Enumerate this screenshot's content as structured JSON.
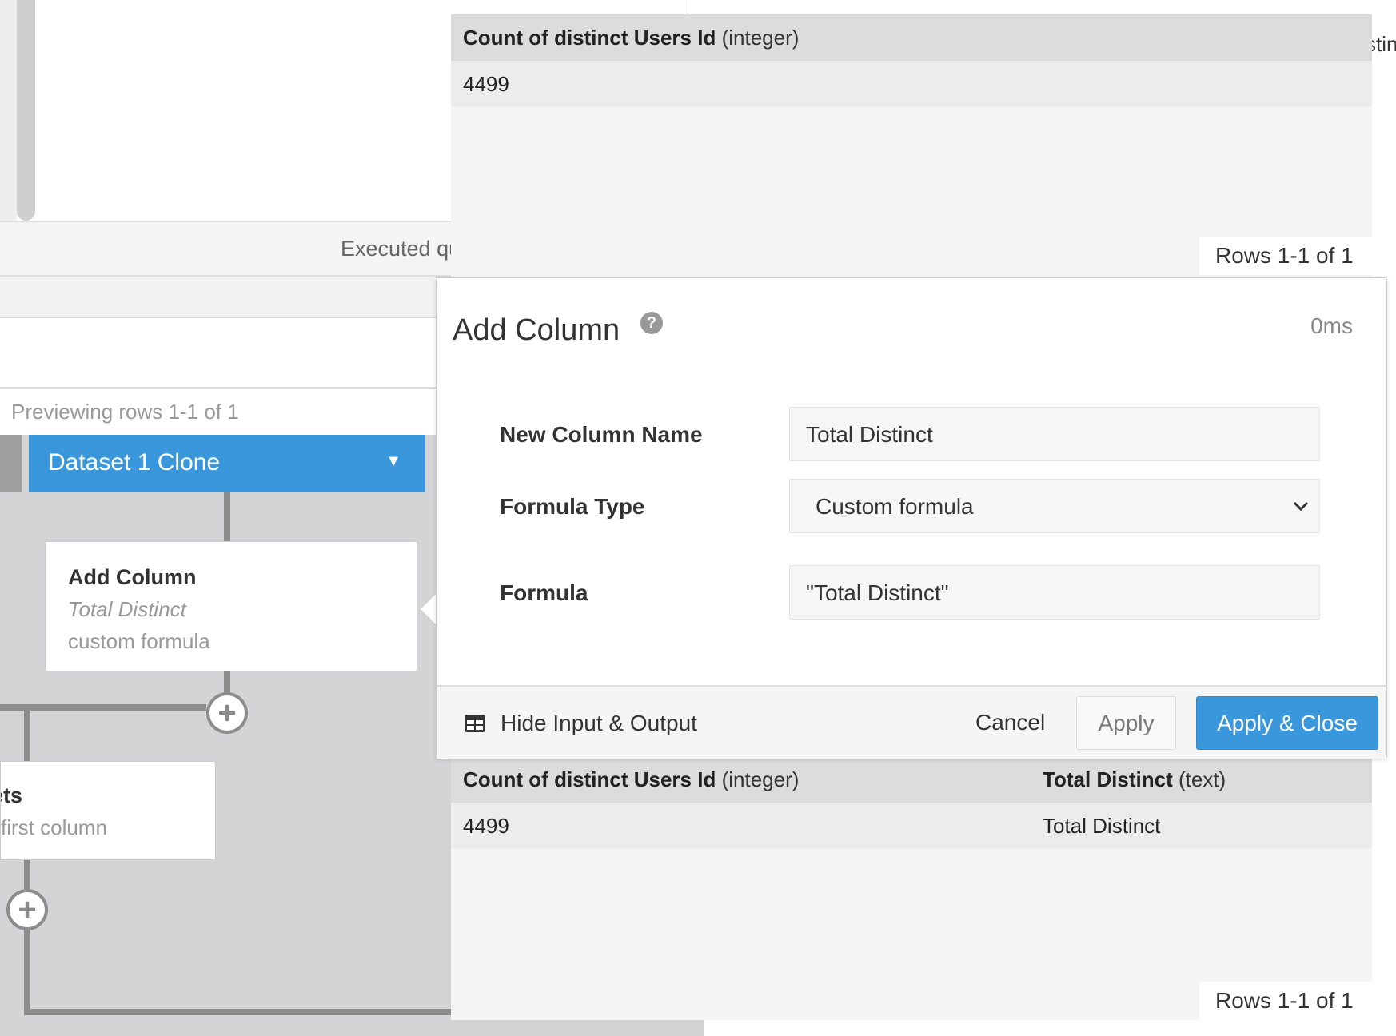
{
  "background": {
    "status_text": "Executed qu",
    "preview_text": "Previewing rows 1-1 of 1"
  },
  "workflow": {
    "dataset_label": "Dataset 1 Clone",
    "dataset_caret": "▼",
    "steps": [
      {
        "title": "Add Column",
        "subtitle": "Total Distinct",
        "detail": "custom formula"
      },
      {
        "title": "ets",
        "detail": "first column"
      }
    ],
    "add_step_symbol": "+"
  },
  "top_result": {
    "columns": [
      {
        "name": "Count of distinct Users Id",
        "type": "(integer)"
      }
    ],
    "rows": [
      [
        "4499"
      ]
    ],
    "rows_info": "Rows 1-1 of 1",
    "edge_header_fragment": "stin"
  },
  "popup": {
    "title": "Add Column",
    "help_symbol": "?",
    "timer": "0ms",
    "fields": {
      "new_column_name": {
        "label": "New Column Name",
        "value": "Total Distinct"
      },
      "formula_type": {
        "label": "Formula Type",
        "selected": "Custom formula"
      },
      "formula": {
        "label": "Formula",
        "value": "\"Total Distinct\""
      }
    },
    "footer": {
      "hide_label": "Hide Input & Output",
      "cancel_label": "Cancel",
      "apply_label": "Apply",
      "apply_close_label": "Apply & Close"
    }
  },
  "bottom_result": {
    "columns": [
      {
        "name": "Count of distinct Users Id",
        "type": "(integer)"
      },
      {
        "name": "Total Distinct",
        "type": "(text)"
      }
    ],
    "rows": [
      [
        "4499",
        "Total Distinct"
      ]
    ],
    "rows_info": "Rows 1-1 of 1"
  },
  "colors": {
    "accent": "#3b97dc",
    "canvas": "#d4d4d6",
    "table_header": "#dcdcdc",
    "table_row": "#ececec"
  },
  "icons": {
    "help": "question-circle-icon",
    "select": "chevron-down-icon",
    "hide": "table-icon",
    "add_step": "plus-circle-icon",
    "dataset": "caret-down-icon"
  }
}
